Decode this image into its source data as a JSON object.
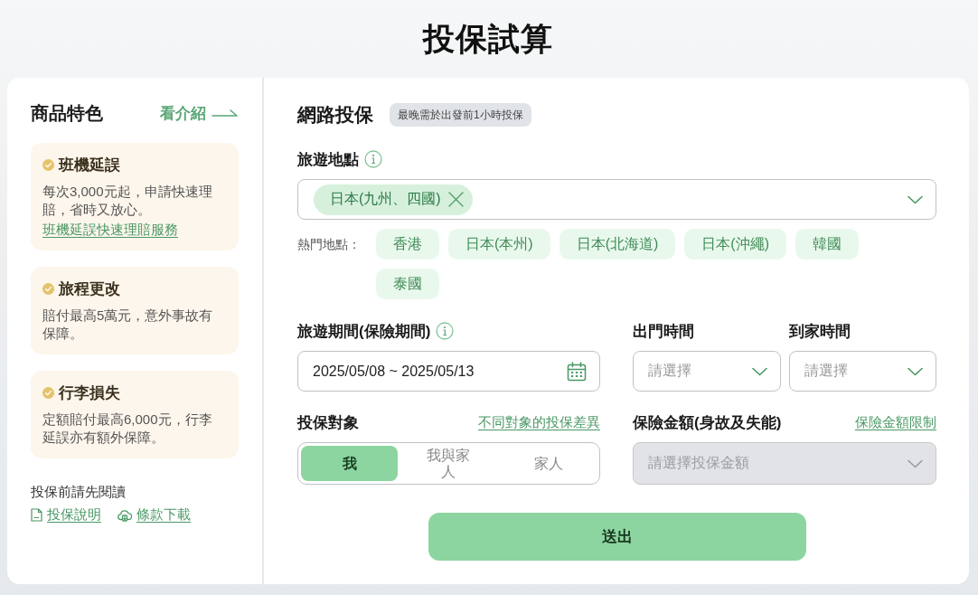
{
  "page_title": "投保試算",
  "features_panel": {
    "title": "商品特色",
    "intro_link": "看介紹",
    "features": [
      {
        "title": "班機延誤",
        "description": "每次3,000元起，申請快速理賠，省時又放心。",
        "link": "班機延誤快速理賠服務"
      },
      {
        "title": "旅程更改",
        "description": "賠付最高5萬元，意外事故有保障。"
      },
      {
        "title": "行李損失",
        "description": "定額賠付最高6,000元，行李延誤亦有額外保障。"
      }
    ],
    "read_first": {
      "label": "投保前請先閱讀",
      "links": [
        {
          "kind": "document",
          "label": "投保說明"
        },
        {
          "kind": "download",
          "label": "條款下載"
        }
      ]
    }
  },
  "form": {
    "title": "網路投保",
    "notice": "最晚需於出發前1小時投保",
    "destination": {
      "label": "旅遊地點",
      "selected_destinations": [
        "日本(九州、四國)"
      ],
      "popular_label": "熱門地點：",
      "popular_destinations": [
        "香港",
        "日本(本州)",
        "日本(北海道)",
        "日本(沖繩)",
        "韓國",
        "泰國"
      ]
    },
    "period": {
      "label": "旅遊期間(保險期間)",
      "value": "2025/05/08 ~ 2025/05/13"
    },
    "departure_time": {
      "label": "出門時間",
      "placeholder": "請選擇"
    },
    "return_time": {
      "label": "到家時間",
      "placeholder": "請選擇"
    },
    "insured": {
      "label": "投保對象",
      "link": "不同對象的投保差異",
      "options": [
        {
          "label": "我",
          "selected": true
        },
        {
          "label": "我與家人",
          "selected": false
        },
        {
          "label": "家人",
          "selected": false
        }
      ]
    },
    "amount": {
      "label": "保險金額(身故及失能)",
      "link": "保險金額限制",
      "placeholder": "請選擇投保金額",
      "disabled": true
    },
    "submit": "送出"
  }
}
